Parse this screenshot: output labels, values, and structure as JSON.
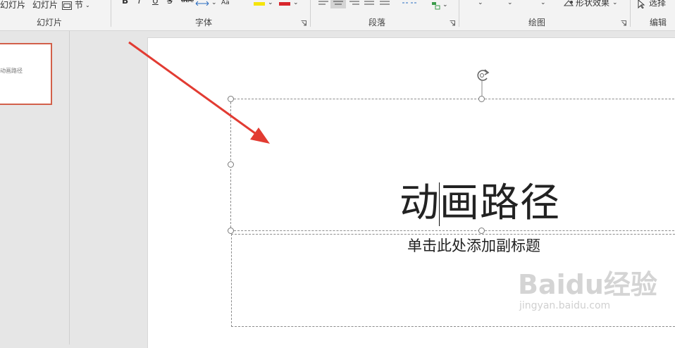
{
  "ribbon": {
    "slides_group": {
      "new_slide_label": "新建幻灯片",
      "new_slide_suffix": "幻灯片",
      "reuse_label": "幻灯片",
      "section_label": "节",
      "group_label": "幻灯片"
    },
    "font_group": {
      "group_label": "字体",
      "bold_label": "B",
      "italic_label": "I",
      "underline_label": "U",
      "strike_label": "S",
      "shadow_label": "abc"
    },
    "paragraph_group": {
      "group_label": "段落"
    },
    "drawing_group": {
      "group_label": "绘图",
      "shape_effects_label": "形状效果"
    },
    "editing_group": {
      "group_label": "编辑",
      "select_label": "选择"
    }
  },
  "thumbnail": {
    "text": "动画路径"
  },
  "slide": {
    "title": "动画路径",
    "subtitle_placeholder": "单击此处添加副标题"
  },
  "watermark": {
    "logo": "Baidu经验",
    "url": "jingyan.baidu.com"
  },
  "colors": {
    "accent": "#d2604a",
    "arrow": "#e23b32",
    "highlight": "#f5e40a",
    "font_color": "#d8262c"
  }
}
